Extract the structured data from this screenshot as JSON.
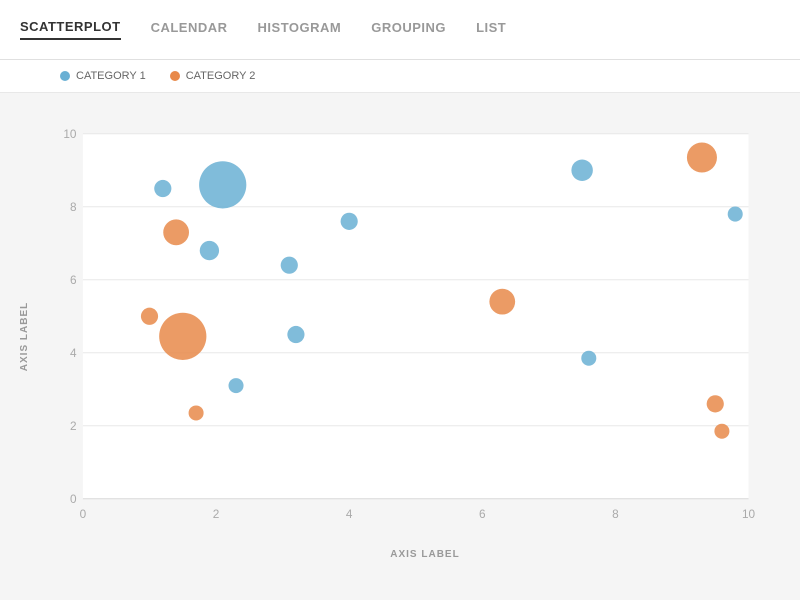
{
  "tabs": [
    {
      "id": "scatterplot",
      "label": "SCATTERPLOT",
      "active": true
    },
    {
      "id": "calendar",
      "label": "CALENDAR",
      "active": false
    },
    {
      "id": "histogram",
      "label": "HISTOGRAM",
      "active": false
    },
    {
      "id": "grouping",
      "label": "GROUPING",
      "active": false
    },
    {
      "id": "list",
      "label": "LIST",
      "active": false
    }
  ],
  "legend": [
    {
      "id": "cat1",
      "label": "CATEGORY 1",
      "color": "#6ab0d4"
    },
    {
      "id": "cat2",
      "label": "CATEGORY 2",
      "color": "#e8894a"
    }
  ],
  "chart": {
    "x_axis_label": "AXIS LABEL",
    "y_axis_label": "AXIS LABEL",
    "x_min": 0,
    "x_max": 10,
    "y_min": 0,
    "y_max": 10,
    "category1_color": "#6ab0d4",
    "category2_color": "#e8894a",
    "points_cat1": [
      {
        "x": 1.2,
        "y": 8.5,
        "r": 8
      },
      {
        "x": 1.9,
        "y": 6.8,
        "r": 9
      },
      {
        "x": 2.1,
        "y": 8.6,
        "r": 22
      },
      {
        "x": 3.1,
        "y": 6.4,
        "r": 8
      },
      {
        "x": 2.3,
        "y": 3.1,
        "r": 7
      },
      {
        "x": 3.2,
        "y": 4.5,
        "r": 8
      },
      {
        "x": 4.0,
        "y": 7.6,
        "r": 8
      },
      {
        "x": 7.5,
        "y": 9.0,
        "r": 10
      },
      {
        "x": 7.6,
        "y": 3.85,
        "r": 7
      },
      {
        "x": 9.8,
        "y": 7.8,
        "r": 7
      }
    ],
    "points_cat2": [
      {
        "x": 1.0,
        "y": 5.0,
        "r": 8
      },
      {
        "x": 1.4,
        "y": 7.3,
        "r": 12
      },
      {
        "x": 1.5,
        "y": 4.45,
        "r": 22
      },
      {
        "x": 1.7,
        "y": 2.35,
        "r": 7
      },
      {
        "x": 6.3,
        "y": 5.4,
        "r": 12
      },
      {
        "x": 9.3,
        "y": 9.35,
        "r": 14
      },
      {
        "x": 9.5,
        "y": 2.6,
        "r": 8
      },
      {
        "x": 9.6,
        "y": 1.85,
        "r": 7
      }
    ]
  }
}
